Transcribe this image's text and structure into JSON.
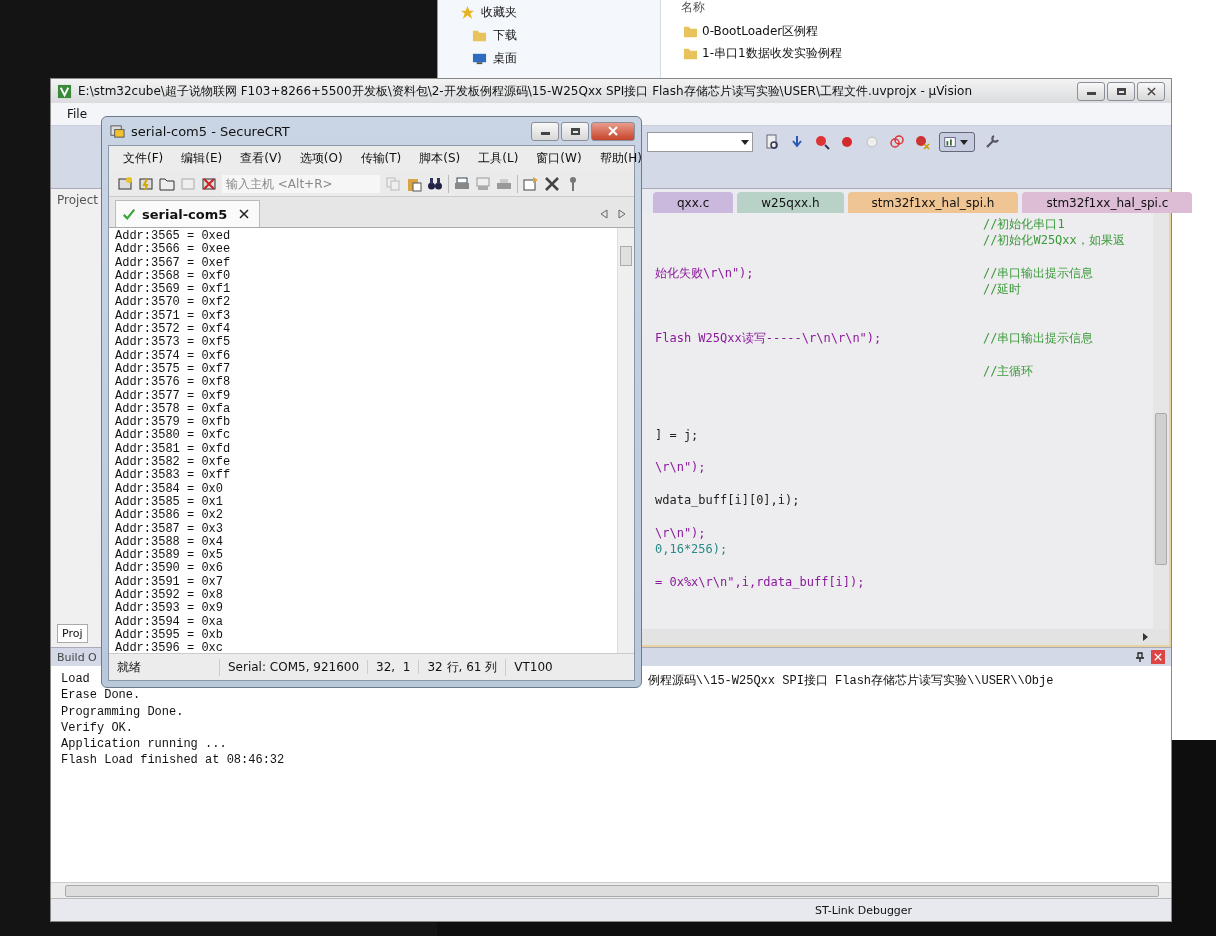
{
  "explorer": {
    "sidebar": [
      {
        "label": "收藏夹",
        "kind": "star"
      },
      {
        "label": "下载",
        "kind": "folder"
      },
      {
        "label": "桌面",
        "kind": "desktop"
      }
    ],
    "column": "名称",
    "files": [
      "0-BootLoader区例程",
      "1-串口1数据收发实验例程"
    ]
  },
  "uvision": {
    "title": "E:\\stm32cube\\超子说物联网 F103+8266+5500开发板\\资料包\\2-开发板例程源码\\15-W25Qxx SPI接口 Flash存储芯片读写实验\\USER\\工程文件.uvprojx - µVision",
    "menu": [
      "File"
    ],
    "project_label": "Project",
    "project_tab": "Proj",
    "tabs": [
      {
        "label": "qxx.c",
        "color": "#cbb9dd"
      },
      {
        "label": "w25qxx.h",
        "color": "#b8d2c8"
      },
      {
        "label": "stm32f1xx_hal_spi.h",
        "color": "#f0c594"
      },
      {
        "label": "stm32f1xx_hal_spi.c",
        "color": "#dcbdd5"
      }
    ],
    "code_lines": [
      {
        "comment": "//初始化串口1"
      },
      {
        "comment": "//初始化W25Qxx，如果返"
      },
      {
        "kind": "blank"
      },
      {
        "code": "始化失败\\r\\n\");",
        "kind": "string",
        "comment": "//串口输出提示信息"
      },
      {
        "comment": "//延时"
      },
      {
        "kind": "blank"
      },
      {
        "kind": "blank"
      },
      {
        "code": "Flash W25Qxx读写-----\\r\\n\\r\\n\");",
        "kind": "string",
        "comment": "//串口输出提示信息"
      },
      {
        "kind": "blank"
      },
      {
        "comment": "//主循环"
      },
      {
        "kind": "blank"
      },
      {
        "kind": "blank"
      },
      {
        "kind": "blank"
      },
      {
        "code": "] = j;",
        "kind": "plain"
      },
      {
        "kind": "blank"
      },
      {
        "code": "\\r\\n\");",
        "kind": "string"
      },
      {
        "kind": "blank"
      },
      {
        "code": "wdata_buff[i][0],i);",
        "kind": "plain"
      },
      {
        "kind": "blank"
      },
      {
        "code": "\\r\\n\");",
        "kind": "string"
      },
      {
        "code": "0,16*256);",
        "kind": "number"
      },
      {
        "kind": "blank"
      },
      {
        "code": "= 0x%x\\r\\n\",i,rdata_buff[i]);",
        "kind": "string"
      }
    ],
    "build_title": "Build O",
    "build_first": "Load",
    "build_first_tail": "例程源码\\\\15-W25Qxx SPI接口 Flash存储芯片读写实验\\\\USER\\\\Obje",
    "build_lines": [
      "Erase Done.",
      "Programming Done.",
      "Verify OK.",
      "Application running ...",
      "Flash Load finished at 08:46:32"
    ],
    "status": "ST-Link Debugger"
  },
  "securecrt": {
    "title": "serial-com5 - SecureCRT",
    "menu": [
      "文件(F)",
      "编辑(E)",
      "查看(V)",
      "选项(O)",
      "传输(T)",
      "脚本(S)",
      "工具(L)",
      "窗口(W)",
      "帮助(H)"
    ],
    "host_placeholder": "输入主机 <Alt+R>",
    "tab": {
      "label": "serial-com5",
      "connected": true
    },
    "lines": [
      "Addr:3565 = 0xed",
      "Addr:3566 = 0xee",
      "Addr:3567 = 0xef",
      "Addr:3568 = 0xf0",
      "Addr:3569 = 0xf1",
      "Addr:3570 = 0xf2",
      "Addr:3571 = 0xf3",
      "Addr:3572 = 0xf4",
      "Addr:3573 = 0xf5",
      "Addr:3574 = 0xf6",
      "Addr:3575 = 0xf7",
      "Addr:3576 = 0xf8",
      "Addr:3577 = 0xf9",
      "Addr:3578 = 0xfa",
      "Addr:3579 = 0xfb",
      "Addr:3580 = 0xfc",
      "Addr:3581 = 0xfd",
      "Addr:3582 = 0xfe",
      "Addr:3583 = 0xff",
      "Addr:3584 = 0x0",
      "Addr:3585 = 0x1",
      "Addr:3586 = 0x2",
      "Addr:3587 = 0x3",
      "Addr:3588 = 0x4",
      "Addr:3589 = 0x5",
      "Addr:3590 = 0x6",
      "Addr:3591 = 0x7",
      "Addr:3592 = 0x8",
      "Addr:3593 = 0x9",
      "Addr:3594 = 0xa",
      "Addr:3595 = 0xb",
      "Addr:3596 = 0xc"
    ],
    "status": [
      "就绪",
      "Serial: COM5, 921600",
      "32,  1",
      "32 行, 61 列",
      "VT100"
    ]
  }
}
